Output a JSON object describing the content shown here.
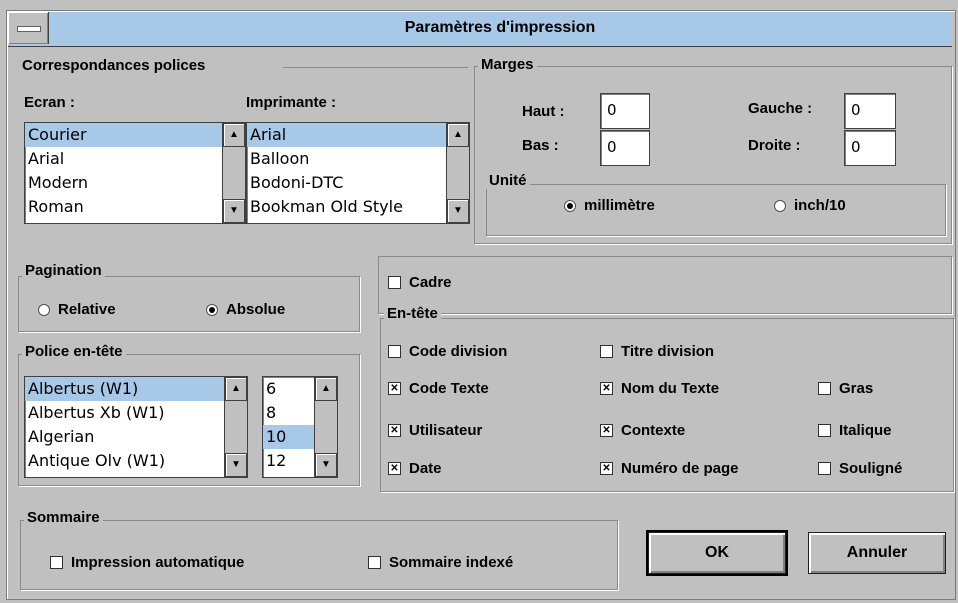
{
  "window": {
    "title": "Paramètres d'impression"
  },
  "fonts_mapping": {
    "label": "Correspondances polices",
    "screen_label": "Ecran :",
    "printer_label": "Imprimante :",
    "screen_fonts": [
      "Courier",
      "Arial",
      "Modern",
      "Roman"
    ],
    "printer_fonts": [
      "Arial",
      "Balloon",
      "Bodoni-DTC",
      "Bookman Old Style"
    ]
  },
  "margins": {
    "label": "Marges",
    "top_label": "Haut :",
    "top_value": "0",
    "bottom_label": "Bas :",
    "bottom_value": "0",
    "left_label": "Gauche :",
    "left_value": "0",
    "right_label": "Droite :",
    "right_value": "0",
    "unit_label": "Unité",
    "unit_mm": "millimètre",
    "unit_inch": "inch/10",
    "unit_selected": "millimètre"
  },
  "pagination": {
    "label": "Pagination",
    "relative": "Relative",
    "absolute": "Absolue",
    "selected": "Absolue"
  },
  "header_font": {
    "label": "Police en-tête",
    "fonts": [
      "Albertus (W1)",
      "Albertus Xb (W1)",
      "Algerian",
      "Antique Olv (W1)"
    ],
    "sizes": [
      "6",
      "8",
      "10",
      "12"
    ]
  },
  "frame": {
    "label": "Cadre",
    "checked": false
  },
  "header": {
    "label": "En-tête",
    "code_division": {
      "label": "Code division",
      "checked": false
    },
    "titre_division": {
      "label": "Titre division",
      "checked": false
    },
    "code_texte": {
      "label": "Code Texte",
      "checked": true
    },
    "nom_texte": {
      "label": "Nom du Texte",
      "checked": true
    },
    "gras": {
      "label": "Gras",
      "checked": false
    },
    "utilisateur": {
      "label": "Utilisateur",
      "checked": true
    },
    "contexte": {
      "label": "Contexte",
      "checked": true
    },
    "italique": {
      "label": "Italique",
      "checked": false
    },
    "date": {
      "label": "Date",
      "checked": true
    },
    "numero_page": {
      "label": "Numéro de page",
      "checked": true
    },
    "souligne": {
      "label": "Souligné",
      "checked": false
    }
  },
  "summary": {
    "label": "Sommaire",
    "auto_print": {
      "label": "Impression automatique",
      "checked": false
    },
    "indexed": {
      "label": "Sommaire indexé",
      "checked": false
    }
  },
  "buttons": {
    "ok": "OK",
    "cancel": "Annuler"
  },
  "icons": {
    "up": "▲",
    "down": "▼",
    "check": "✕"
  }
}
